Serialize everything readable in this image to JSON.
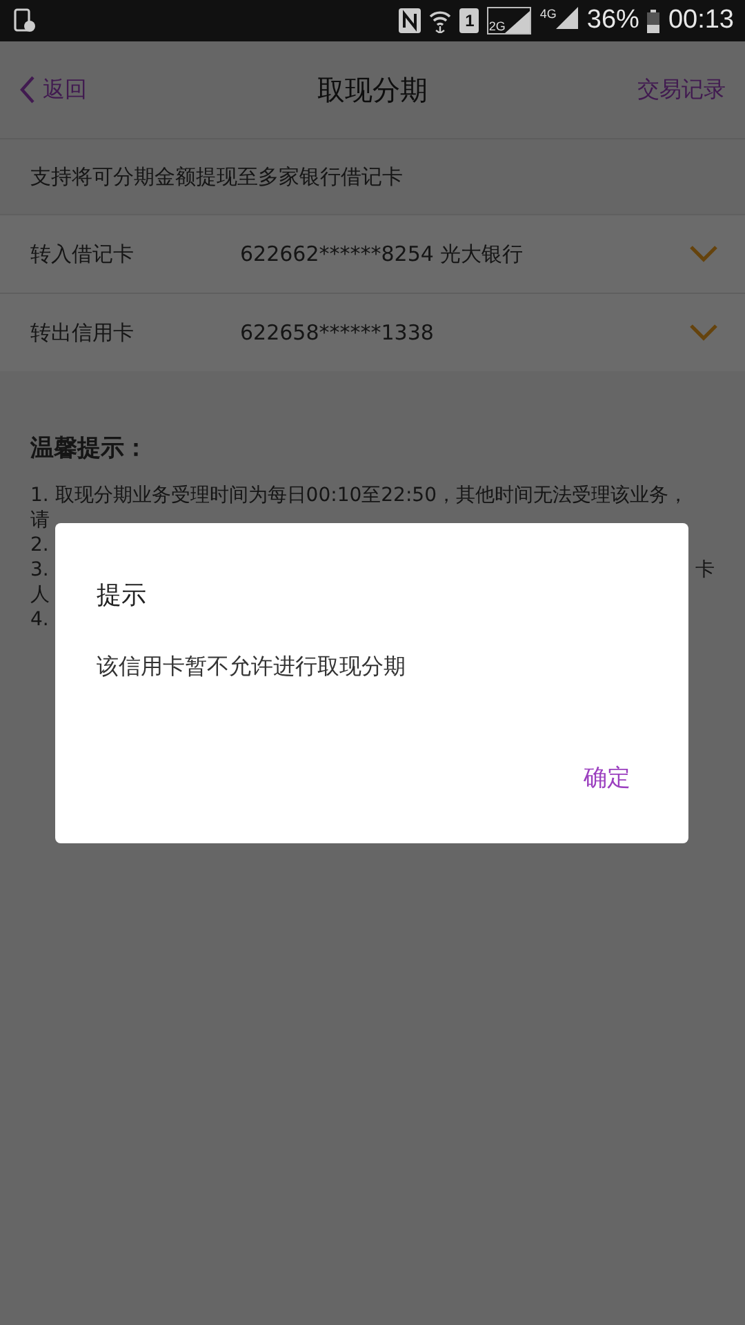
{
  "status_bar": {
    "sim_label": "1",
    "network_2g": "2G",
    "network_4g": "4G",
    "battery": "36%",
    "time": "00:13"
  },
  "header": {
    "back": "返回",
    "title": "取现分期",
    "action": "交易记录"
  },
  "notice": "支持将可分期金额提现至多家银行借记卡",
  "card_rows": [
    {
      "label": "转入借记卡",
      "value": "622662******8254 光大银行"
    },
    {
      "label": "转出信用卡",
      "value": "622658******1338"
    }
  ],
  "tips": {
    "title": "温馨提示：",
    "lines": [
      {
        "text": "1. 取现分期业务受理时间为每日00:10至22:50，其他时间无法受理该业务，"
      },
      {
        "text": "请"
      },
      {
        "text": "2."
      },
      {
        "text": "3.",
        "tail": "卡"
      },
      {
        "text": "人"
      },
      {
        "text": "4."
      }
    ]
  },
  "dialog": {
    "title": "提示",
    "message": "该信用卡暂不允许进行取现分期",
    "confirm": "确定"
  }
}
